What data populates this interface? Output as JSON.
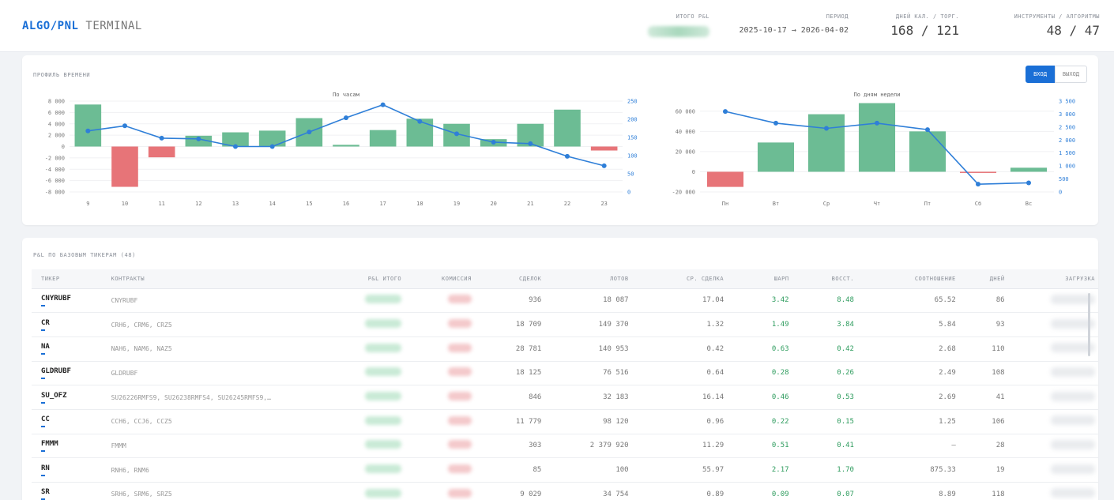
{
  "header": {
    "brand_algo": "ALGO",
    "brand_sep": "/",
    "brand_pnl": "PNL",
    "brand_terminal": "TERMINAL",
    "total_pnl_label": "ИТОГО P&L",
    "period_label": "ПЕРИОД",
    "period_value": "2025-10-17 → 2026-04-02",
    "days_label": "ДНЕЙ КАЛ. / ТОРГ.",
    "days_value": "168 / 121",
    "instr_label": "ИНСТРУМЕНТЫ / АЛГОРИТМЫ",
    "instr_value": "48 / 47"
  },
  "time_profile": {
    "title": "ПРОФИЛЬ ВРЕМЕНИ",
    "toggle_entry": "ВХОД",
    "toggle_exit": "ВЫХОД",
    "active_toggle": "entry"
  },
  "chart_data": [
    {
      "type": "bar",
      "title": "По часам",
      "categories": [
        "9",
        "10",
        "11",
        "12",
        "13",
        "14",
        "15",
        "16",
        "17",
        "18",
        "19",
        "20",
        "21",
        "22",
        "23"
      ],
      "series": [
        {
          "values": [
            7400,
            -7100,
            -1900,
            1900,
            2500,
            2800,
            5000,
            300,
            2900,
            4900,
            4000,
            1300,
            4000,
            6500,
            -700
          ]
        },
        {
          "type": "line",
          "axis": "right",
          "values": [
            168,
            182,
            148,
            146,
            125,
            125,
            165,
            204,
            240,
            194,
            160,
            137,
            133,
            98,
            72
          ]
        }
      ],
      "y_left_ticks": [
        "8 000",
        "6 000",
        "4 000",
        "2 000",
        "0",
        "-2 000",
        "-4 000",
        "-6 000",
        "-8 000"
      ],
      "y_right_ticks": [
        "250",
        "200",
        "150",
        "100",
        "50",
        "0"
      ],
      "ylim": [
        -8000,
        8000
      ],
      "ylim_right": [
        0,
        250
      ],
      "colors": {
        "positive": "#6cbc94",
        "negative": "#e77478",
        "line": "#2f7fd8"
      }
    },
    {
      "type": "bar",
      "title": "По дням недели",
      "categories": [
        "Пн",
        "Вт",
        "Ср",
        "Чт",
        "Пт",
        "Сб",
        "Вс"
      ],
      "series": [
        {
          "values": [
            -15000,
            29000,
            57000,
            68000,
            40000,
            -500,
            4000
          ]
        },
        {
          "type": "line",
          "axis": "right",
          "values": [
            3100,
            2650,
            2450,
            2650,
            2400,
            300,
            350
          ]
        }
      ],
      "y_left_ticks": [
        "60 000",
        "40 000",
        "20 000",
        "0",
        "-20 000"
      ],
      "y_right_ticks": [
        "3 500",
        "3 000",
        "2 500",
        "2 000",
        "1 500",
        "1 000",
        "500",
        "0"
      ],
      "ylim": [
        -20000,
        70000
      ],
      "ylim_right": [
        0,
        3500
      ],
      "colors": {
        "positive": "#6cbc94",
        "negative": "#e77478",
        "line": "#2f7fd8"
      }
    }
  ],
  "tickers": {
    "title": "P&L ПО БАЗОВЫМ ТИКЕРАМ (48)",
    "columns": [
      "ТИКЕР",
      "КОНТРАКТЫ",
      "P&L ИТОГО",
      "КОМИССИЯ",
      "СДЕЛОК",
      "ЛОТОВ",
      "СР. СДЕЛКА",
      "ШАРП",
      "ВОССТ.",
      "СООТНОШЕНИЕ",
      "ДНЕЙ",
      "ЗАГРУЗКА"
    ],
    "rows": [
      {
        "ticker": "CNYRUBF",
        "contracts": "CNYRUBF",
        "deals": "936",
        "lots": "18 087",
        "avg": "17.04",
        "sharpe": "3.42",
        "recov": "8.48",
        "ratio": "65.52",
        "days": "86"
      },
      {
        "ticker": "CR",
        "contracts": "CRH6, CRM6, CRZ5",
        "deals": "18 709",
        "lots": "149 370",
        "avg": "1.32",
        "sharpe": "1.49",
        "recov": "3.84",
        "ratio": "5.84",
        "days": "93"
      },
      {
        "ticker": "NA",
        "contracts": "NAH6, NAM6, NAZ5",
        "deals": "28 781",
        "lots": "140 953",
        "avg": "0.42",
        "sharpe": "0.63",
        "recov": "0.42",
        "ratio": "2.68",
        "days": "110"
      },
      {
        "ticker": "GLDRUBF",
        "contracts": "GLDRUBF",
        "deals": "18 125",
        "lots": "76 516",
        "avg": "0.64",
        "sharpe": "0.28",
        "recov": "0.26",
        "ratio": "2.49",
        "days": "108"
      },
      {
        "ticker": "SU_OFZ",
        "contracts": "SU26226RMFS9, SU26238RMFS4, SU26245RMFS9,…",
        "deals": "846",
        "lots": "32 183",
        "avg": "16.14",
        "sharpe": "0.46",
        "recov": "0.53",
        "ratio": "2.69",
        "days": "41"
      },
      {
        "ticker": "CC",
        "contracts": "CCH6, CCJ6, CCZ5",
        "deals": "11 779",
        "lots": "98 120",
        "avg": "0.96",
        "sharpe": "0.22",
        "recov": "0.15",
        "ratio": "1.25",
        "days": "106"
      },
      {
        "ticker": "FMMM",
        "contracts": "FMMM",
        "deals": "303",
        "lots": "2 379 920",
        "avg": "11.29",
        "sharpe": "0.51",
        "recov": "0.41",
        "ratio": "—",
        "days": "28"
      },
      {
        "ticker": "RN",
        "contracts": "RNH6, RNM6",
        "deals": "85",
        "lots": "100",
        "avg": "55.97",
        "sharpe": "2.17",
        "recov": "1.70",
        "ratio": "875.33",
        "days": "19"
      },
      {
        "ticker": "SR",
        "contracts": "SRH6, SRM6, SRZ5",
        "deals": "9 029",
        "lots": "34 754",
        "avg": "0.89",
        "sharpe": "0.09",
        "recov": "0.07",
        "ratio": "8.89",
        "days": "118"
      }
    ]
  }
}
